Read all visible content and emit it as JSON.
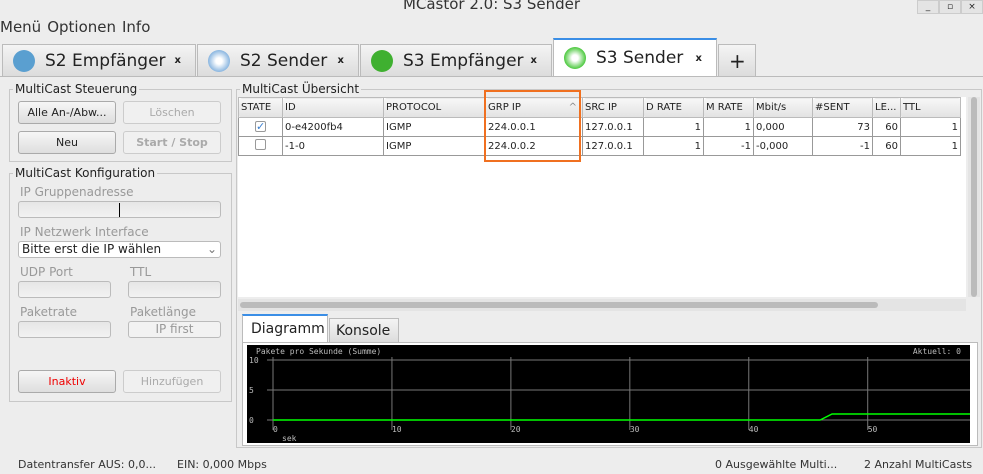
{
  "window": {
    "title": "MCastor 2.0: S3 Sender",
    "controls": [
      "_",
      "▫",
      "×"
    ]
  },
  "menu": [
    "Menü",
    "Optionen",
    "Info"
  ],
  "tabs": [
    {
      "label": "S2 Empfänger",
      "close": "x",
      "icon": "satellite-dish-icon",
      "color": "#5a9fd0"
    },
    {
      "label": "S2 Sender",
      "close": "x",
      "icon": "antenna-icon",
      "color": "#8ab6e0"
    },
    {
      "label": "S3 Empfänger",
      "close": "x",
      "icon": "satellite-dish-icon",
      "color": "#3fb030"
    },
    {
      "label": "S3 Sender",
      "close": "x",
      "icon": "antenna-icon",
      "color": "#4cc93e",
      "active": true
    }
  ],
  "add_tab": "+",
  "steuerung": {
    "title": "MultiCast Steuerung",
    "all": "Alle An-/Abw...",
    "delete": "Löschen",
    "new": "Neu",
    "startstop": "Start / Stop"
  },
  "konfig": {
    "title": "MultiCast Konfiguration",
    "ip_group": "IP Gruppenadresse",
    "ip_if": "IP Netzwerk Interface",
    "ip_if_value": "Bitte erst die IP wählen",
    "udp": "UDP Port",
    "ttl": "TTL",
    "rate": "Paketrate",
    "len": "Paketlänge",
    "len_value": "IP first",
    "inactive": "Inaktiv",
    "add": "Hinzufügen"
  },
  "overview": {
    "title": "MultiCast Übersicht",
    "columns": [
      "STATE",
      "ID",
      "PROTOCOL",
      "GRP IP",
      "SRC IP",
      "D RATE",
      "M RATE",
      "Mbit/s",
      "#SENT",
      "LE...",
      "TTL"
    ],
    "sort_indicator": "^",
    "rows": [
      {
        "checked": true,
        "cells": [
          "0-e4200fb4",
          "IGMP",
          "224.0.0.1",
          "127.0.0.1",
          "1",
          "1",
          "0,000",
          "73",
          "60",
          "1"
        ]
      },
      {
        "checked": false,
        "cells": [
          "-1-0",
          "IGMP",
          "224.0.0.2",
          "127.0.0.1",
          "1",
          "-1",
          "-0,000",
          "-1",
          "60",
          "1"
        ]
      }
    ],
    "highlight_color": "#f07020"
  },
  "bottom_tabs": [
    "Diagramm",
    "Konsole"
  ],
  "chart_data": {
    "type": "line",
    "title": "Pakete pro Sekunde (Summe)",
    "current": "Aktuell: 0",
    "xlabel": "sek",
    "xlim": [
      0,
      58.6
    ],
    "ylim": [
      0,
      10
    ],
    "xticks": [
      0,
      10,
      20,
      30,
      40,
      50
    ],
    "yticks": [
      0,
      5,
      10
    ],
    "grid": true,
    "line_color": "#00ff00",
    "x": [
      0,
      46,
      47,
      58.6
    ],
    "y": [
      0,
      0,
      1,
      1
    ]
  },
  "status": {
    "out": "Datentransfer AUS: 0,0...",
    "in": "EIN: 0,000 Mbps",
    "selected": "0 Ausgewählte Multi...",
    "count": "2 Anzahl MultiCasts"
  }
}
